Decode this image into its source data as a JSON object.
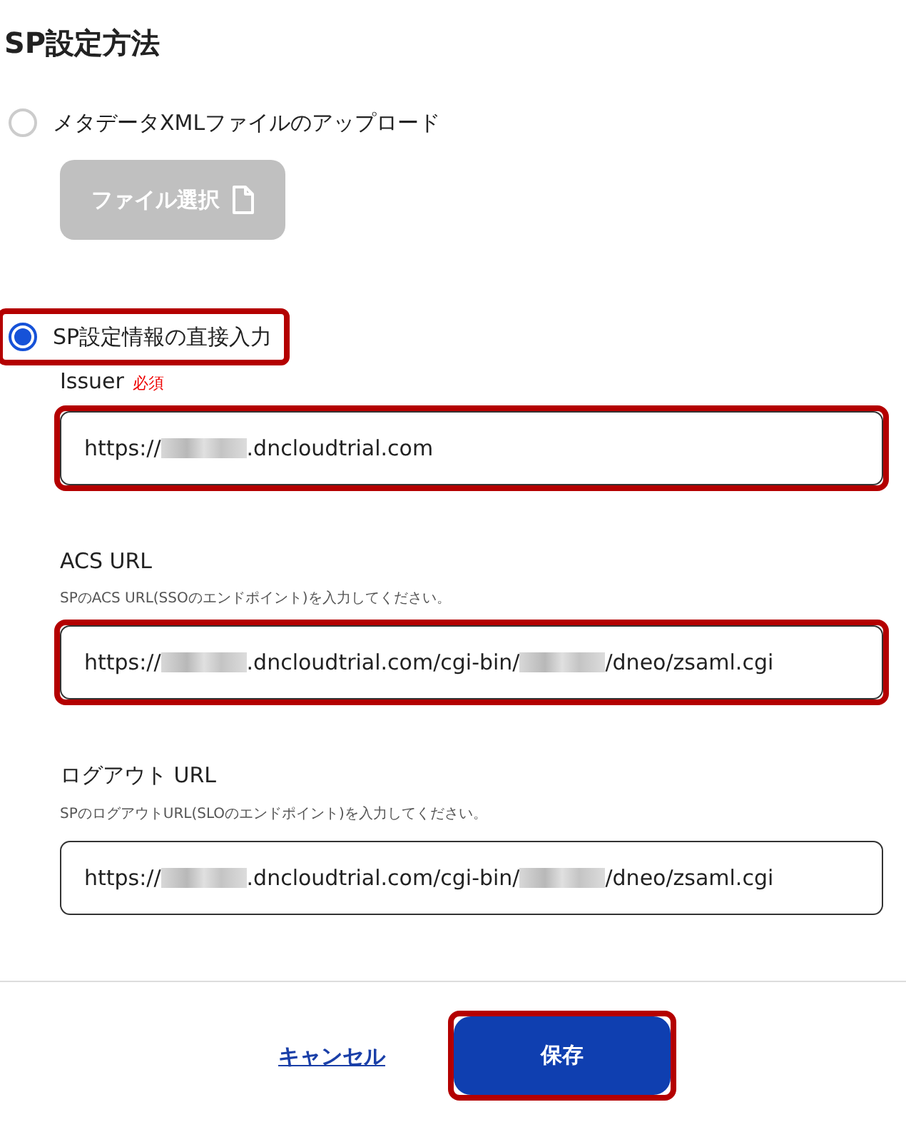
{
  "heading": "SP設定方法",
  "options": [
    {
      "label": "メタデータXMLファイルのアップロード",
      "selected": false,
      "button": {
        "label": "ファイル選択",
        "disabled": true
      }
    },
    {
      "label": "SP設定情報の直接入力",
      "selected": true,
      "highlighted": true
    }
  ],
  "fields": [
    {
      "label": "Issuer",
      "required": "必須",
      "highlighted": true,
      "value_parts": [
        {
          "kind": "text",
          "text": "https://"
        },
        {
          "kind": "redacted"
        },
        {
          "kind": "text",
          "text": ".dncloudtrial.com"
        }
      ]
    },
    {
      "label": "ACS URL",
      "hint": "SPのACS URL(SSOのエンドポイント)を入力してください。",
      "highlighted": true,
      "value_parts": [
        {
          "kind": "text",
          "text": "https://"
        },
        {
          "kind": "redacted"
        },
        {
          "kind": "text",
          "text": ".dncloudtrial.com/cgi-bin/"
        },
        {
          "kind": "redacted"
        },
        {
          "kind": "text",
          "text": "/dneo/zsaml.cgi"
        }
      ]
    },
    {
      "label": "ログアウト URL",
      "hint": "SPのログアウトURL(SLOのエンドポイント)を入力してください。",
      "highlighted": false,
      "value_parts": [
        {
          "kind": "text",
          "text": "https://"
        },
        {
          "kind": "redacted"
        },
        {
          "kind": "text",
          "text": ".dncloudtrial.com/cgi-bin/"
        },
        {
          "kind": "redacted"
        },
        {
          "kind": "text",
          "text": "/dneo/zsaml.cgi"
        }
      ]
    }
  ],
  "actions": [
    {
      "kind": "link",
      "label": "キャンセル",
      "highlighted": false
    },
    {
      "kind": "primary",
      "label": "保存",
      "highlighted": true
    }
  ]
}
